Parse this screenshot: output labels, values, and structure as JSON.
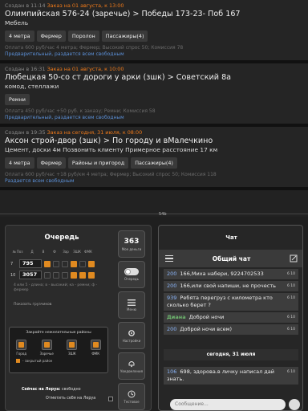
{
  "orders": [
    {
      "created": "Создан в 11:14",
      "deadline": "Заказ на 01 августа, к 13:00",
      "title": "Олимпийская 576-24 (заречье) > Победы 173-23- Поб 167",
      "cargo": "Мебель",
      "tags": [
        "4 метра",
        "Фермер",
        "Поролон",
        "Пассажиры(4)"
      ],
      "price": "Оплата 600 руб/час 4 метра; Фермер; Высокий спрос 50; Комиссия 78",
      "note": "Предварительный, раздается всем свободным"
    },
    {
      "created": "Создан в 16:31",
      "deadline": "Заказ на 01 августа, к 10:00",
      "title": "Любецкая 50-со ст дороги у арки (зшк) > Советский 8а",
      "cargo": "комод, стеллажи",
      "tags": [
        "Ремни"
      ],
      "price": "Оплата 450 руб/час +50 руб. к заказу; Ремни; Комиссия 58",
      "note": "Предварительный, раздается всем свободным"
    },
    {
      "created": "Создан в 19:35",
      "deadline": "Заказ на сегодня, 31 июля, к 08:00",
      "title": "Аксон строй-двор (зшк) > По городу и вМалечкино",
      "cargo": "Цемент, доски 4м Позвонить клиенту Примерное расстояние 17 км",
      "tags": [
        "4 метра",
        "Фермер",
        "Районы и пригород",
        "Пассажиры(4)"
      ],
      "price": "Оплата 600 руб/час +18 руб/км 4 метра; Фермер; Высокий спрос 50; Комиссия 118",
      "note": "Раздается всем свободным"
    }
  ],
  "divider_label": "54b",
  "queue": {
    "title": "Очередь",
    "columns": [
      "№ Поз",
      "Д",
      "В",
      "Ф",
      "Зар",
      "ЗШК",
      "ФМК"
    ],
    "rows": [
      {
        "num": "795",
        "pos": "7"
      },
      {
        "num": "3057",
        "pos": "10"
      }
    ],
    "legend": "4 или 5 - длина; в - высокий; ка - ремни; ф - фермер",
    "show_trucks": "Показать грузчиков",
    "areas_title": "Закройте нежелательные районы",
    "areas": [
      "Город",
      "Заречье",
      "ЗШК",
      "ФМК"
    ],
    "closed_legend": "- закрытый район",
    "free_text": "Сейчас на Леруа:",
    "free_value": "свободно",
    "mark_text": "Отметить себя на Леруа"
  },
  "side": {
    "count": "363",
    "count_label": "Мое деньги",
    "queue_label": "Очередь",
    "menu_label": "Меню",
    "settings_label": "Настройки",
    "notif_label": "Уведомления",
    "test_label": "Тестовое"
  },
  "chat": {
    "title": "Чат",
    "channel": "Общий чат",
    "messages": [
      {
        "id": "200",
        "text": "166,Миха набери, 9224702533",
        "rating": "6 10"
      },
      {
        "id": "200",
        "text": "166,или свой напиши, не прочесть",
        "rating": "6 10"
      },
      {
        "id": "939",
        "text": "Ребята перегруз с километра кто сколько берет ?",
        "rating": "6 10"
      },
      {
        "id": "Диана",
        "text": "Доброй ночи",
        "rating": "6 10"
      },
      {
        "id": "200",
        "text": "Доброй ночи всем)",
        "rating": "6 10"
      }
    ],
    "date_sep": "сегодня, 31 июля",
    "messages2": [
      {
        "id": "106",
        "text": "698, здорова.в личку написал дай знать.",
        "rating": "6 10"
      }
    ],
    "input_placeholder": "Сообщение..."
  }
}
